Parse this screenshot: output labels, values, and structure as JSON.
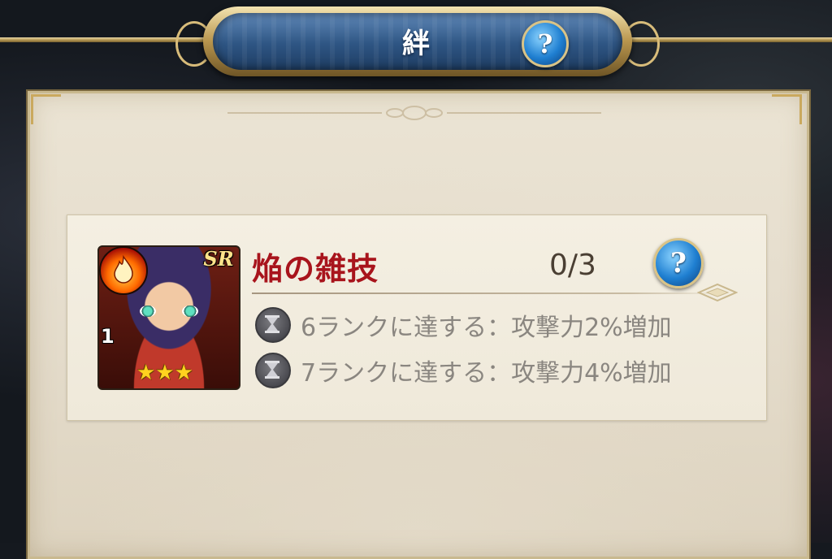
{
  "header": {
    "title": "絆",
    "help_label": "?"
  },
  "bond": {
    "card": {
      "element_icon": "fire-element-icon",
      "rarity": "SR",
      "level": "1",
      "stars": "★★★",
      "star_count": 3
    },
    "skill_name": "焔の雑技",
    "progress": "0/3",
    "help_label": "?",
    "requirements": [
      {
        "icon": "hourglass-icon",
        "text": "6ランクに達する：攻撃力2%増加"
      },
      {
        "icon": "hourglass-icon",
        "text": "7ランクに達する：攻撃力4%増加"
      }
    ]
  },
  "colors": {
    "skill_name": "#a8141c",
    "requirement_text": "#8a8680",
    "help_button": "#1f7fd1"
  }
}
